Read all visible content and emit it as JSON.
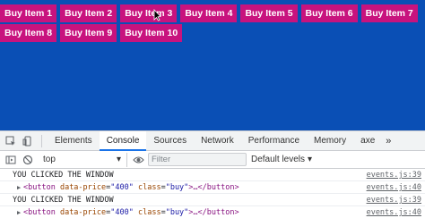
{
  "page": {
    "buttons": [
      "Buy Item 1",
      "Buy Item 2",
      "Buy Item 3",
      "Buy Item 4",
      "Buy Item 5",
      "Buy Item 6",
      "Buy Item 7",
      "Buy Item 8",
      "Buy Item 9",
      "Buy Item 10"
    ],
    "background_color": "#0a4fb5",
    "button_color": "#c8137e"
  },
  "devtools": {
    "tabs": [
      "Elements",
      "Console",
      "Sources",
      "Network",
      "Performance",
      "Memory",
      "axe"
    ],
    "active_tab": "Console",
    "more_label": "»",
    "context_value": "top",
    "filter_placeholder": "Filter",
    "levels_label": "Default levels",
    "log": [
      {
        "text": "YOU CLICKED THE WINDOW",
        "source": "events.js:39"
      },
      {
        "tag_open": "<button",
        "attr1": "data-price",
        "val1": "\"400\"",
        "attr2": "class",
        "val2": "\"buy\"",
        "tag_close": ">…</button>",
        "source": "events.js:40"
      },
      {
        "text": "YOU CLICKED THE WINDOW",
        "source": "events.js:39"
      },
      {
        "tag_open": "<button",
        "attr1": "data-price",
        "val1": "\"400\"",
        "attr2": "class",
        "val2": "\"buy\"",
        "tag_close": ">…</button>",
        "source": "events.js:40"
      }
    ],
    "accent_color": "#1a73e8"
  }
}
